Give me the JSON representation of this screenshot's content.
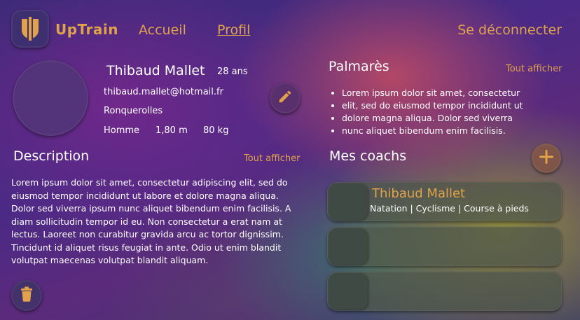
{
  "header": {
    "brand": "UpTrain",
    "nav": [
      {
        "label": "Accueil"
      },
      {
        "label": "Profil"
      }
    ],
    "logout_label": "Se déconnecter"
  },
  "profile": {
    "name": "Thibaud Mallet",
    "age": "28 ans",
    "email": "thibaud.mallet@hotmail.fr",
    "city": "Ronquerolles",
    "sex": "Homme",
    "height": "1,80 m",
    "weight": "80 kg"
  },
  "description": {
    "title": "Description",
    "show_all": "Tout afficher",
    "text": "Lorem ipsum dolor sit amet, consectetur adipiscing elit, sed do eiusmod tempor incididunt ut labore et dolore magna aliqua. Dolor sed viverra ipsum nunc aliquet bibendum enim facilisis. A diam sollicitudin tempor id eu. Non consectetur a erat nam at lectus. Laoreet non curabitur gravida arcu ac tortor dignissim. Tincidunt id aliquet risus feugiat in ante. Odio ut enim blandit volutpat maecenas volutpat blandit aliquam."
  },
  "palmares": {
    "title": "Palmarès",
    "show_all": "Tout afficher",
    "items": [
      "Lorem ipsum dolor sit amet, consectetur",
      "elit, sed do eiusmod tempor incididunt ut",
      "dolore magna aliqua. Dolor sed viverra",
      "nunc aliquet bibendum enim facilisis."
    ]
  },
  "coaches": {
    "title": "Mes coachs",
    "cards": [
      {
        "name": "Thibaud Mallet",
        "sports": "Natation | Cyclisme | Course à pieds"
      },
      {
        "name": "",
        "sports": ""
      },
      {
        "name": "",
        "sports": ""
      }
    ]
  },
  "colors": {
    "accent": "#e0a24a",
    "text": "#ffffff"
  },
  "icons": {
    "logo": "uptrain-logo-icon",
    "edit": "pencil-icon",
    "delete": "trash-icon",
    "add": "plus-icon"
  }
}
